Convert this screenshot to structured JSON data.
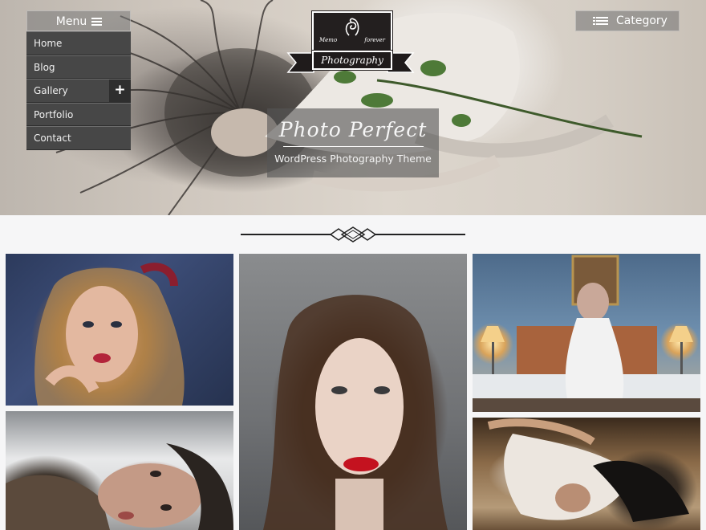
{
  "header": {
    "menu": {
      "label": "Menu",
      "items": [
        {
          "label": "Home"
        },
        {
          "label": "Blog"
        },
        {
          "label": "Gallery",
          "has_submenu": true,
          "expand_symbol": "+"
        },
        {
          "label": "Portfolio"
        },
        {
          "label": "Contact"
        }
      ]
    },
    "category": {
      "label": "Category"
    },
    "logo": {
      "top_left": "Memo",
      "top_right": "forever",
      "ribbon": "Photography"
    },
    "hero_title": "Photo Perfect",
    "hero_subtitle": "WordPress Photography Theme"
  },
  "icons": {
    "menu": "hamburger-icon",
    "category": "list-icon",
    "expand": "plus-icon",
    "divider": "ornament-icon"
  },
  "colors": {
    "menu_bg": "#474747",
    "overlay": "#555555",
    "page_bg": "#f6f6f7"
  },
  "gallery": [
    {
      "alt": "photo-blonde-woman"
    },
    {
      "alt": "photo-red-lips-portrait"
    },
    {
      "alt": "photo-bedroom-lamps"
    },
    {
      "alt": "photo-woman-fur-coat"
    },
    {
      "alt": "photo-woman-lying-down"
    }
  ]
}
